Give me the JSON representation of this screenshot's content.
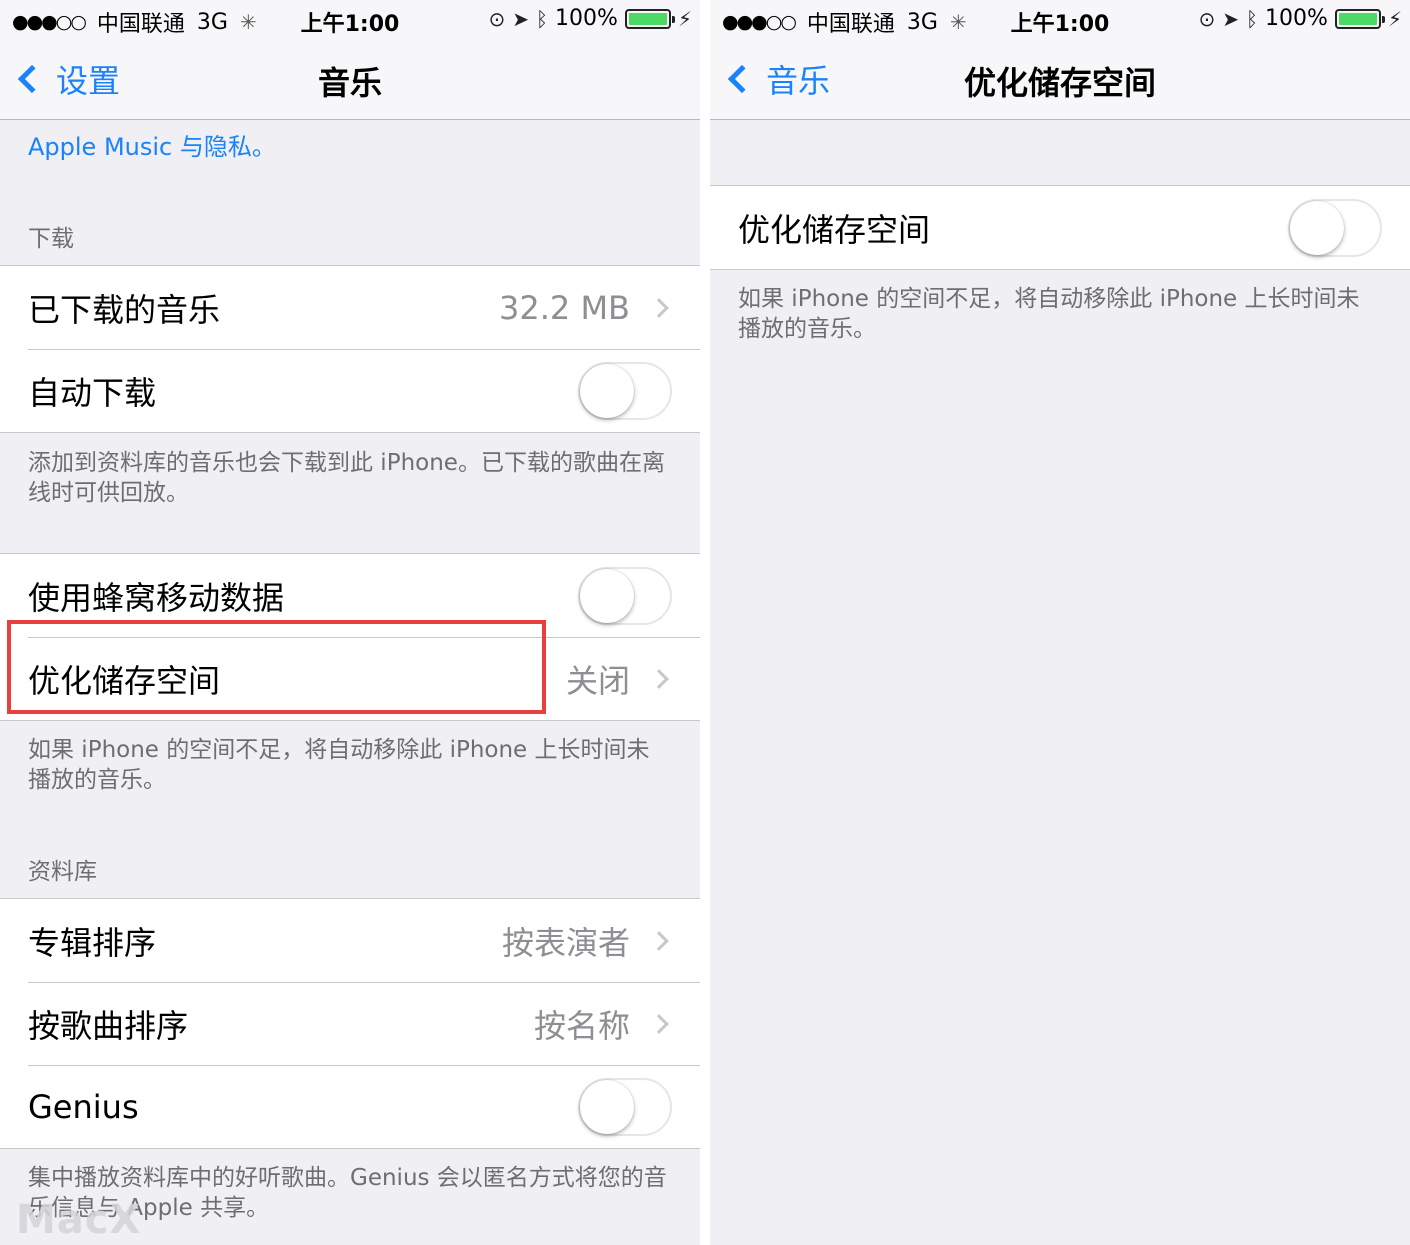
{
  "status_bar": {
    "signal": "●●●○○",
    "carrier": "中国联通",
    "network": "3G",
    "time": "上午1:00",
    "battery_text": "100%",
    "battery_level": 1.0,
    "battery_color": "#4cd964"
  },
  "left_screen": {
    "nav": {
      "back_label": "设置",
      "title": "音乐"
    },
    "privacy_link": "Apple Music 与隐私。",
    "download_section": {
      "header": "下载",
      "rows": [
        {
          "label": "已下载的音乐",
          "value": "32.2 MB"
        },
        {
          "label": "自动下载",
          "toggle_on": false
        }
      ],
      "footer": "添加到资料库的音乐也会下载到此 iPhone。已下载的歌曲在离线时可供回放。"
    },
    "cellular_section": {
      "rows": [
        {
          "label": "使用蜂窝移动数据",
          "toggle_on": false
        },
        {
          "label": "优化储存空间",
          "value": "关闭"
        }
      ],
      "footer": "如果 iPhone 的空间不足，将自动移除此 iPhone 上长时间未播放的音乐。"
    },
    "library_section": {
      "header": "资料库",
      "rows": [
        {
          "label": "专辑排序",
          "value": "按表演者"
        },
        {
          "label": "按歌曲排序",
          "value": "按名称"
        },
        {
          "label": "Genius",
          "toggle_on": false
        }
      ],
      "footer": "集中播放资料库中的好听歌曲。Genius 会以匿名方式将您的音乐信息与 Apple 共享。"
    },
    "highlight_color": "#e8403e"
  },
  "right_screen": {
    "nav": {
      "back_label": "音乐",
      "title": "优化储存空间"
    },
    "row": {
      "label": "优化储存空间",
      "toggle_on": false
    },
    "footer": "如果 iPhone 的空间不足，将自动移除此 iPhone 上长时间未播放的音乐。"
  },
  "watermark": "MacX",
  "colors": {
    "accent": "#1a82fb",
    "background": "#efeff4",
    "secondary_text": "#6d6d72"
  }
}
